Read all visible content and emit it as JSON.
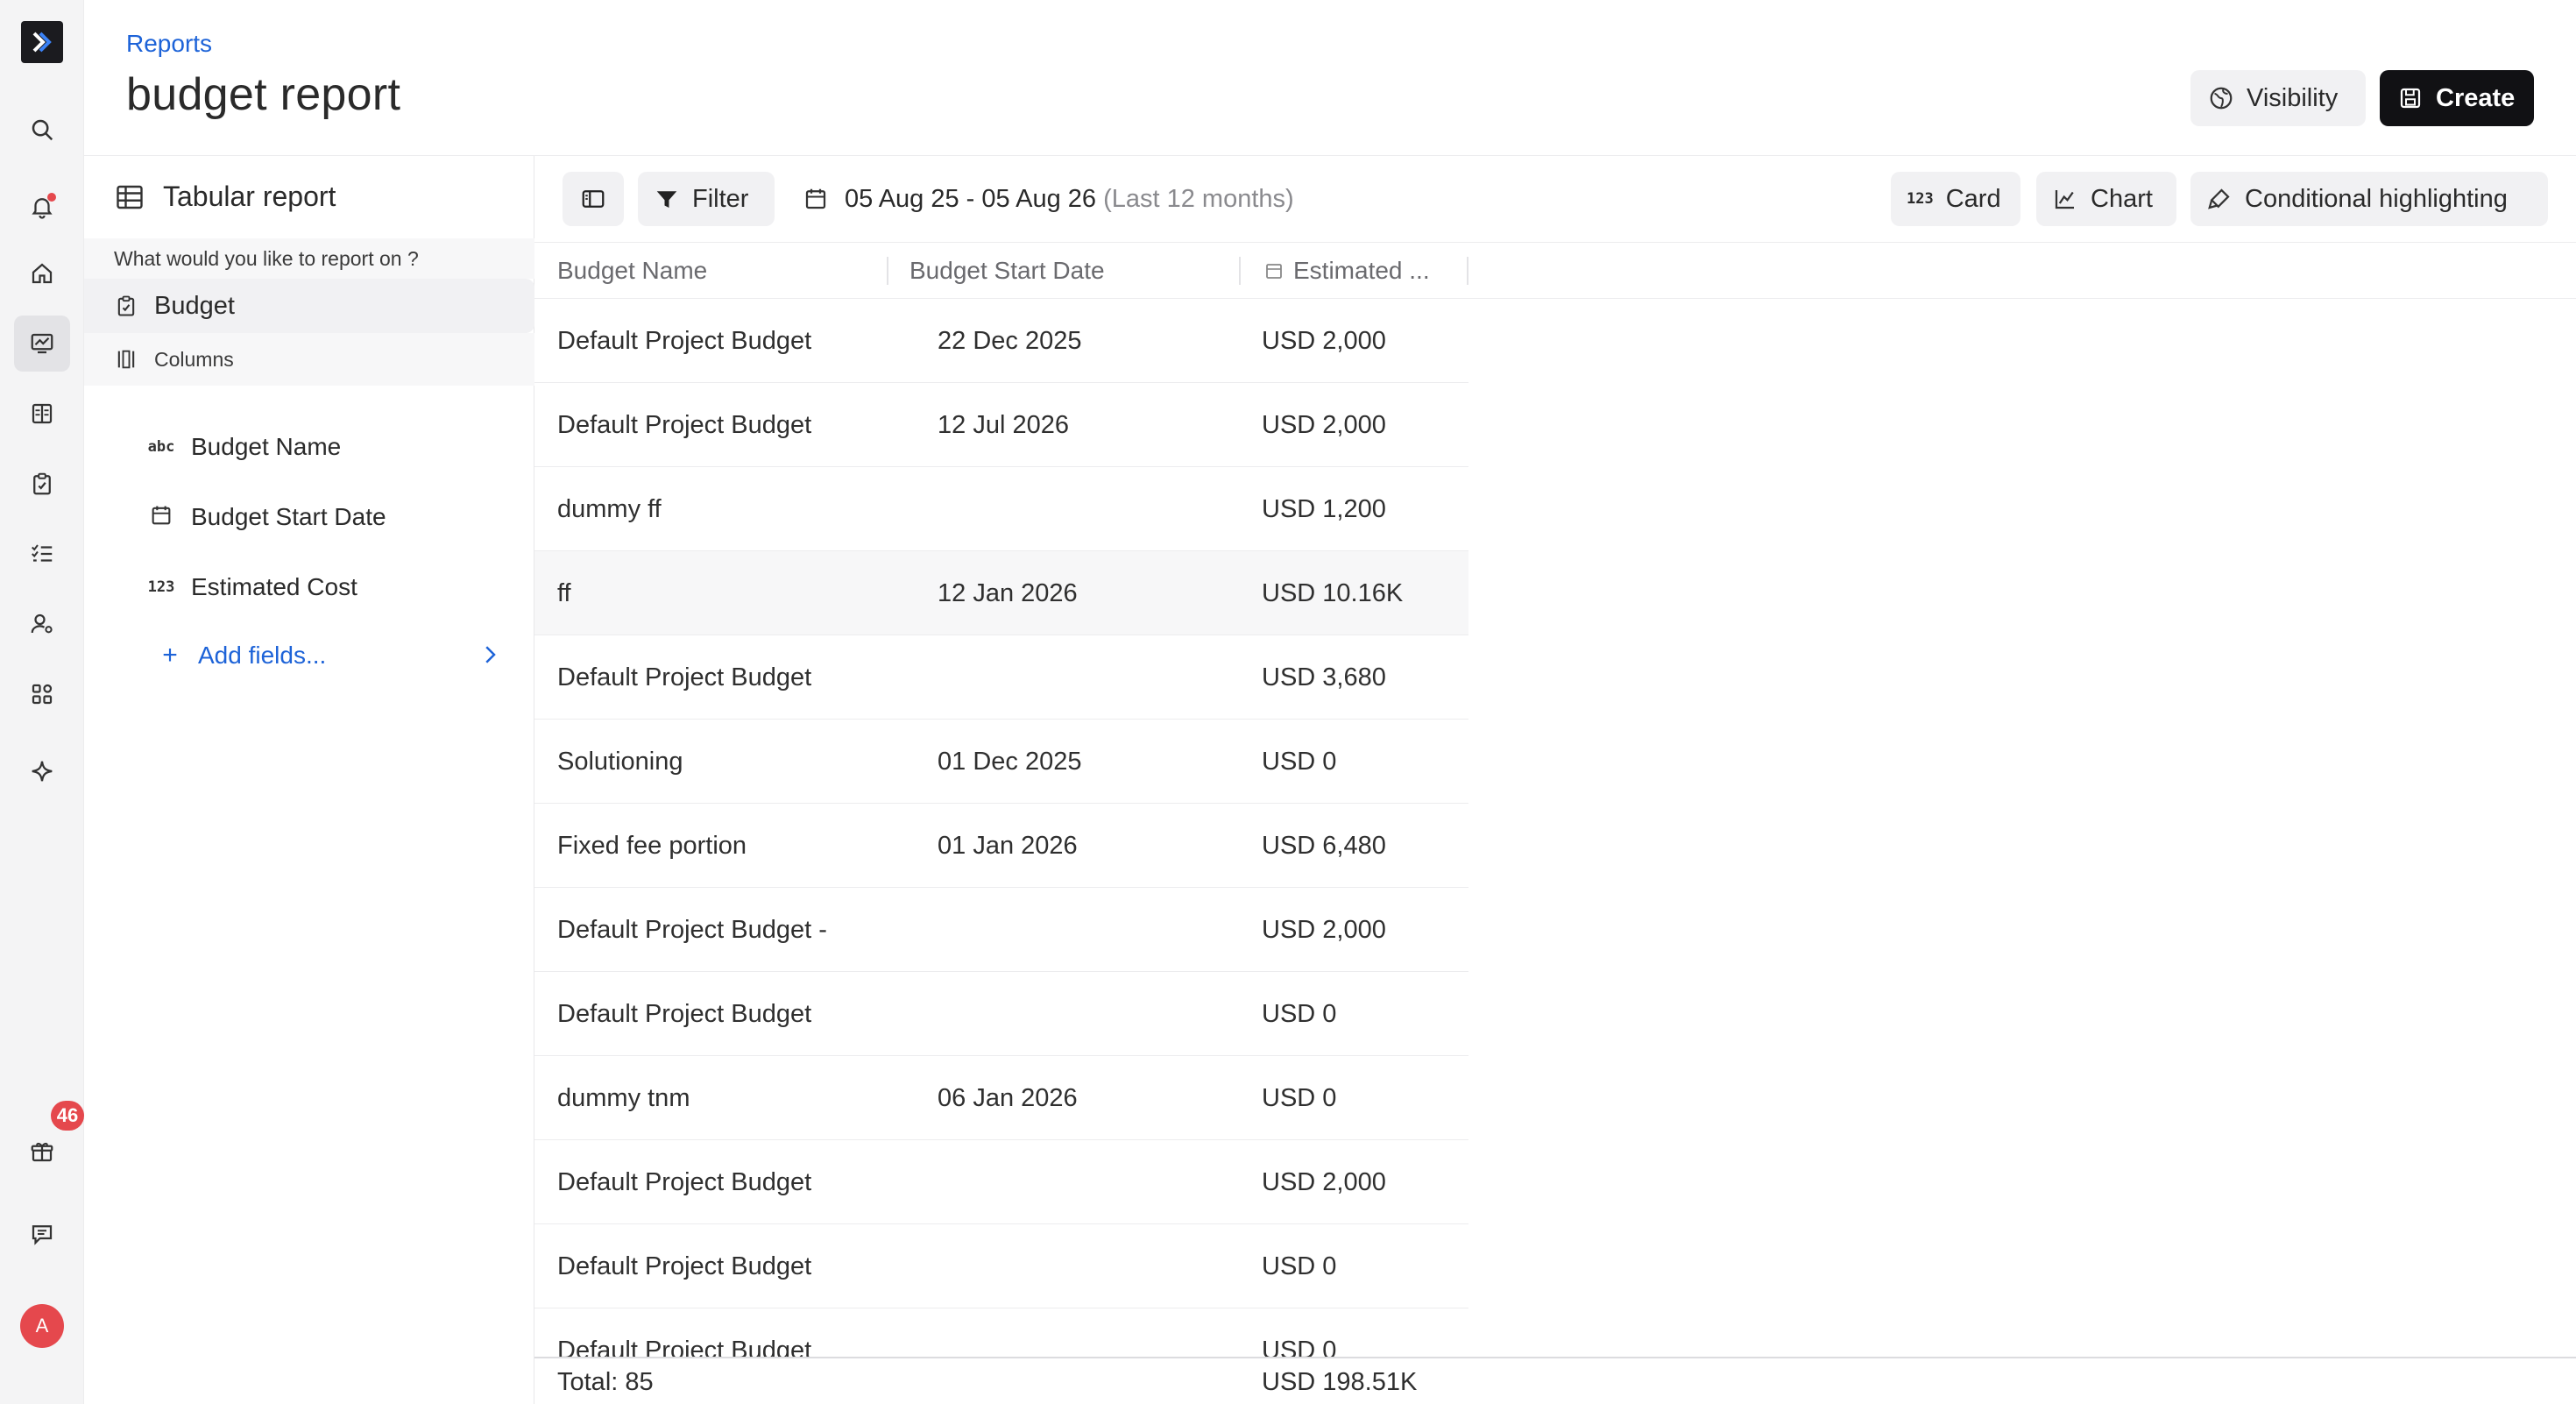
{
  "header": {
    "breadcrumb": "Reports",
    "title": "budget report",
    "visibility_label": "Visibility",
    "create_label": "Create"
  },
  "rail": {
    "gift_badge": "46",
    "avatar_initial": "A"
  },
  "panel": {
    "title": "Tabular report",
    "subtitle": "What would you like to report on ?",
    "entity": "Budget",
    "columns_label": "Columns",
    "fields": [
      {
        "type_icon": "abc",
        "label": "Budget Name"
      },
      {
        "type_icon": "calendar-icon",
        "label": "Budget Start Date"
      },
      {
        "type_icon": "123",
        "label": "Estimated Cost"
      }
    ],
    "add_fields": "Add fields..."
  },
  "toolbar": {
    "filter_label": "Filter",
    "date_range": "05 Aug 25 - 05 Aug 26",
    "date_range_hint": "(Last 12 months)",
    "card_icon": "123",
    "card_label": "Card",
    "chart_label": "Chart",
    "conditional_label": "Conditional highlighting"
  },
  "table": {
    "columns": [
      "Budget Name",
      "Budget Start Date",
      "Estimated ..."
    ],
    "rows": [
      {
        "name": "Default Project Budget",
        "start": "22 Dec 2025",
        "cost": "USD 2,000"
      },
      {
        "name": "Default Project Budget",
        "start": "12 Jul 2026",
        "cost": "USD 2,000"
      },
      {
        "name": "dummy ff",
        "start": "",
        "cost": "USD 1,200"
      },
      {
        "name": "ff",
        "start": "12 Jan 2026",
        "cost": "USD 10.16K"
      },
      {
        "name": "Default Project Budget",
        "start": "",
        "cost": "USD 3,680"
      },
      {
        "name": "Solutioning",
        "start": "01 Dec 2025",
        "cost": "USD 0"
      },
      {
        "name": "Fixed fee portion",
        "start": "01 Jan 2026",
        "cost": "USD 6,480"
      },
      {
        "name": "Default Project Budget -",
        "start": "",
        "cost": "USD 2,000"
      },
      {
        "name": "Default Project Budget",
        "start": "",
        "cost": "USD 0"
      },
      {
        "name": "dummy tnm",
        "start": "06 Jan 2026",
        "cost": "USD 0"
      },
      {
        "name": "Default Project Budget",
        "start": "",
        "cost": "USD 2,000"
      },
      {
        "name": "Default Project Budget",
        "start": "",
        "cost": "USD 0"
      },
      {
        "name": "Default Project Budget",
        "start": "",
        "cost": "USD 0"
      }
    ],
    "total_label": "Total: 85",
    "total_cost": "USD 198.51K"
  }
}
